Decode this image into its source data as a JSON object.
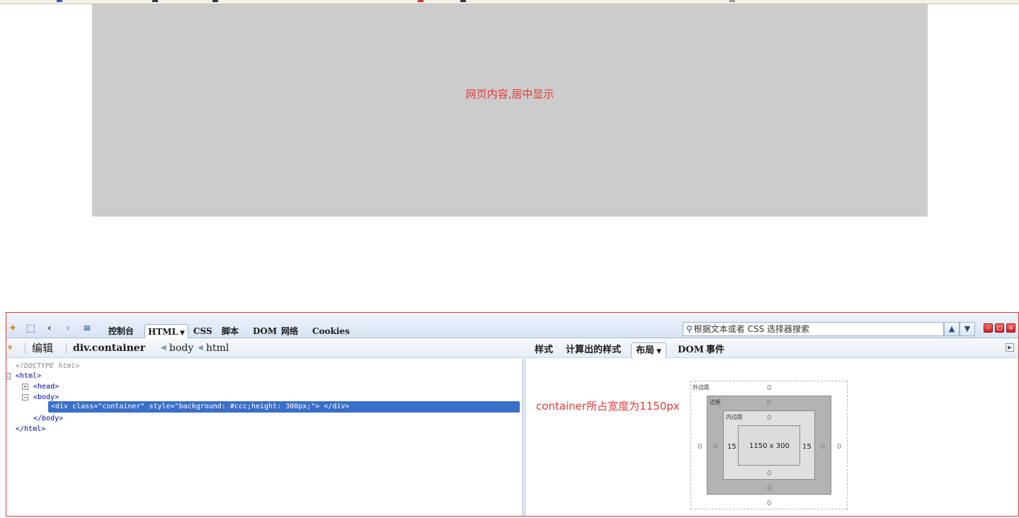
{
  "page": {
    "content_text": "网页内容,居中显示"
  },
  "firebug": {
    "toolbar": {
      "tabs": [
        "控制台",
        "HTML",
        "CSS",
        "脚本",
        "DOM",
        "网络",
        "Cookies"
      ],
      "selected_tab": "HTML",
      "search_placeholder": "根据文本或者 CSS 选择器搜索"
    },
    "breadcrumb": {
      "edit_label": "编辑",
      "items": [
        "div.container",
        "body",
        "html"
      ]
    },
    "side_tabs": [
      "样式",
      "计算出的样式",
      "布局",
      "DOM",
      "事件"
    ],
    "selected_side_tab": "布局",
    "tree": {
      "doctype": "<!DOCTYPE html>",
      "html_open": "<html>",
      "head": "<head>",
      "body_open": "<body>",
      "selected": "<div class=\"container\" style=\"background: #ccc;height: 300px;\"> </div>",
      "body_close": "</body>",
      "html_close": "</html>"
    },
    "layout": {
      "annotation": "container所占宽度为1150px",
      "margin_label": "外边距",
      "border_label": "边框",
      "padding_label": "内边距",
      "margin": {
        "top": "0",
        "right": "0",
        "bottom": "0",
        "left": "0"
      },
      "border": {
        "top": "0",
        "right": "0",
        "bottom": "0",
        "left": "0"
      },
      "padding": {
        "top": "0",
        "right": "15",
        "bottom": "0",
        "left": "15"
      },
      "size": "1150 x 300"
    }
  },
  "colors": {
    "highlight_red": "#e53935",
    "selection_blue": "#3a6fc9",
    "page_gray": "#cccccc"
  }
}
